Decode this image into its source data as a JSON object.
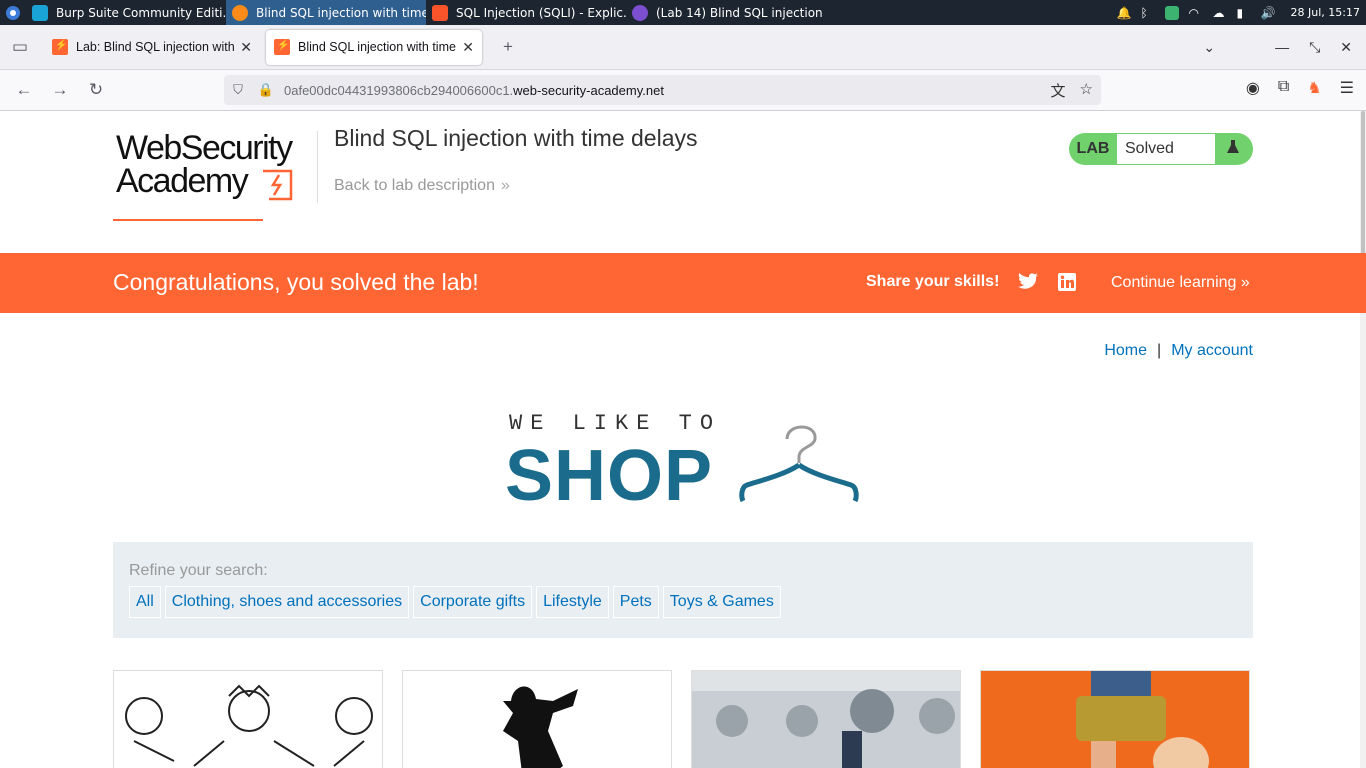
{
  "taskbar": {
    "tasks": [
      {
        "label": "Burp Suite Community Editi...",
        "color": "#ff6633"
      },
      {
        "label": "Blind SQL injection with time...",
        "color": "#ff8c1a"
      },
      {
        "label": "SQL Injection (SQLI) - Explic...",
        "color": "#fb542b"
      },
      {
        "label": "(Lab 14) Blind SQL injection ...",
        "color": "#7b4fd0"
      }
    ],
    "clock": "28 Jul, 15:17"
  },
  "browser": {
    "tabs": [
      {
        "label": "Lab: Blind SQL injection with t"
      },
      {
        "label": "Blind SQL injection with time c"
      }
    ],
    "url_prefix": "0afe00dc04431993806cb294006600c1.",
    "url_host": "web-security-academy.net"
  },
  "header": {
    "logo_line1": "WebSecurity",
    "logo_line2": "Academy",
    "lab_title": "Blind SQL injection with time delays",
    "back_link": "Back to lab description",
    "badge_label": "LAB",
    "badge_status": "Solved",
    "badge_color": "#70d16d"
  },
  "banner": {
    "message": "Congratulations, you solved the lab!",
    "share": "Share your skills!",
    "continue": "Continue learning",
    "color": "#ff6633"
  },
  "nav": {
    "home": "Home",
    "separator": "|",
    "account": "My account"
  },
  "shop_logo": {
    "small": "WE LIKE TO",
    "big": "SHOP"
  },
  "filter": {
    "label": "Refine your search:",
    "categories": [
      "All",
      "Clothing, shoes and accessories",
      "Corporate gifts",
      "Lifestyle",
      "Pets",
      "Toys & Games"
    ]
  }
}
